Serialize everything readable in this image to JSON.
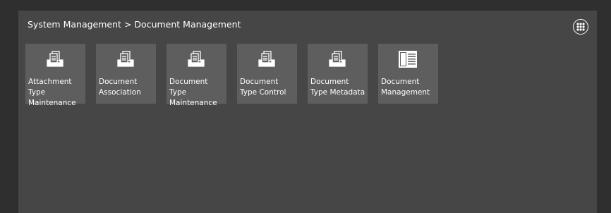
{
  "breadcrumb": {
    "parent": "System Management",
    "separator": ">",
    "current": "Document Management"
  },
  "menu_icon": "grid-menu-icon",
  "tiles": [
    {
      "label": "Attachment Type Maintenance",
      "icon": "document-tray-icon"
    },
    {
      "label": "Document Association",
      "icon": "document-tray-icon"
    },
    {
      "label": "Document Type Maintenance",
      "icon": "document-tray-icon"
    },
    {
      "label": "Document Type Control",
      "icon": "document-tray-icon"
    },
    {
      "label": "Document Type Metadata",
      "icon": "document-tray-icon"
    },
    {
      "label": "Document Management",
      "icon": "document-list-icon"
    }
  ],
  "colors": {
    "page_bg": "#2f2f2f",
    "panel_bg": "#464646",
    "tile_bg": "#5e5e5e",
    "text": "#ffffff"
  }
}
